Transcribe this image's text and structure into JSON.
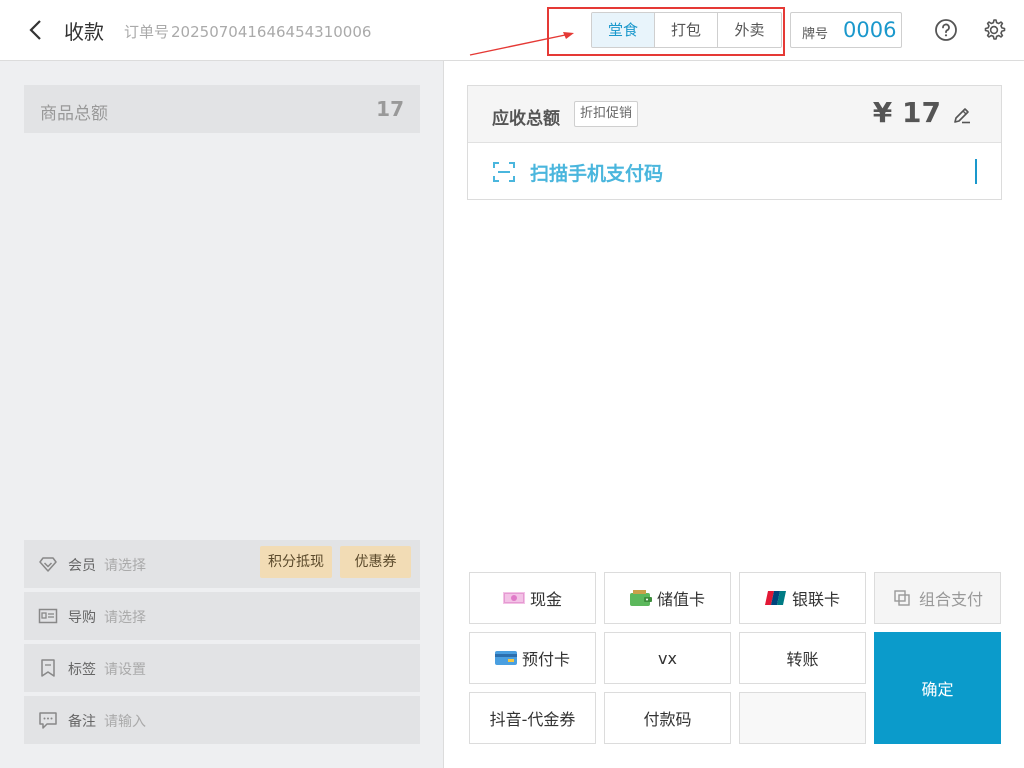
{
  "header": {
    "title": "收款",
    "order_label": "订单号",
    "order_number": "20250704164645431000​6",
    "modes": [
      "堂食",
      "打包",
      "外卖"
    ],
    "active_mode": "堂食",
    "tag_label": "牌号",
    "tag_value": "0006"
  },
  "left": {
    "subtotal_label": "商品总额",
    "subtotal_value": "17",
    "rows": [
      {
        "label": "会员",
        "hint": "请选择"
      },
      {
        "label": "导购",
        "hint": "请选择"
      },
      {
        "label": "标签",
        "hint": "请设置"
      },
      {
        "label": "备注",
        "hint": "请输入"
      }
    ],
    "chips": [
      "积分抵现",
      "优惠券"
    ]
  },
  "amount": {
    "label": "应收总额",
    "discount_button": "折扣促销",
    "value": "¥ 17",
    "scan_text": "扫描手机支付码"
  },
  "payments": {
    "cash": "现金",
    "stored_card": "储值卡",
    "unionpay": "银联卡",
    "combo": "组合支付",
    "prepaid": "预付卡",
    "vx": "vx",
    "transfer": "转账",
    "douyin": "抖音-代金券",
    "paycode": "付款码",
    "confirm": "确定"
  },
  "colors": {
    "accent": "#1a98cc",
    "confirm": "#0b9bcb",
    "chip": "#f2dcb5",
    "highlight": "#e53935"
  }
}
